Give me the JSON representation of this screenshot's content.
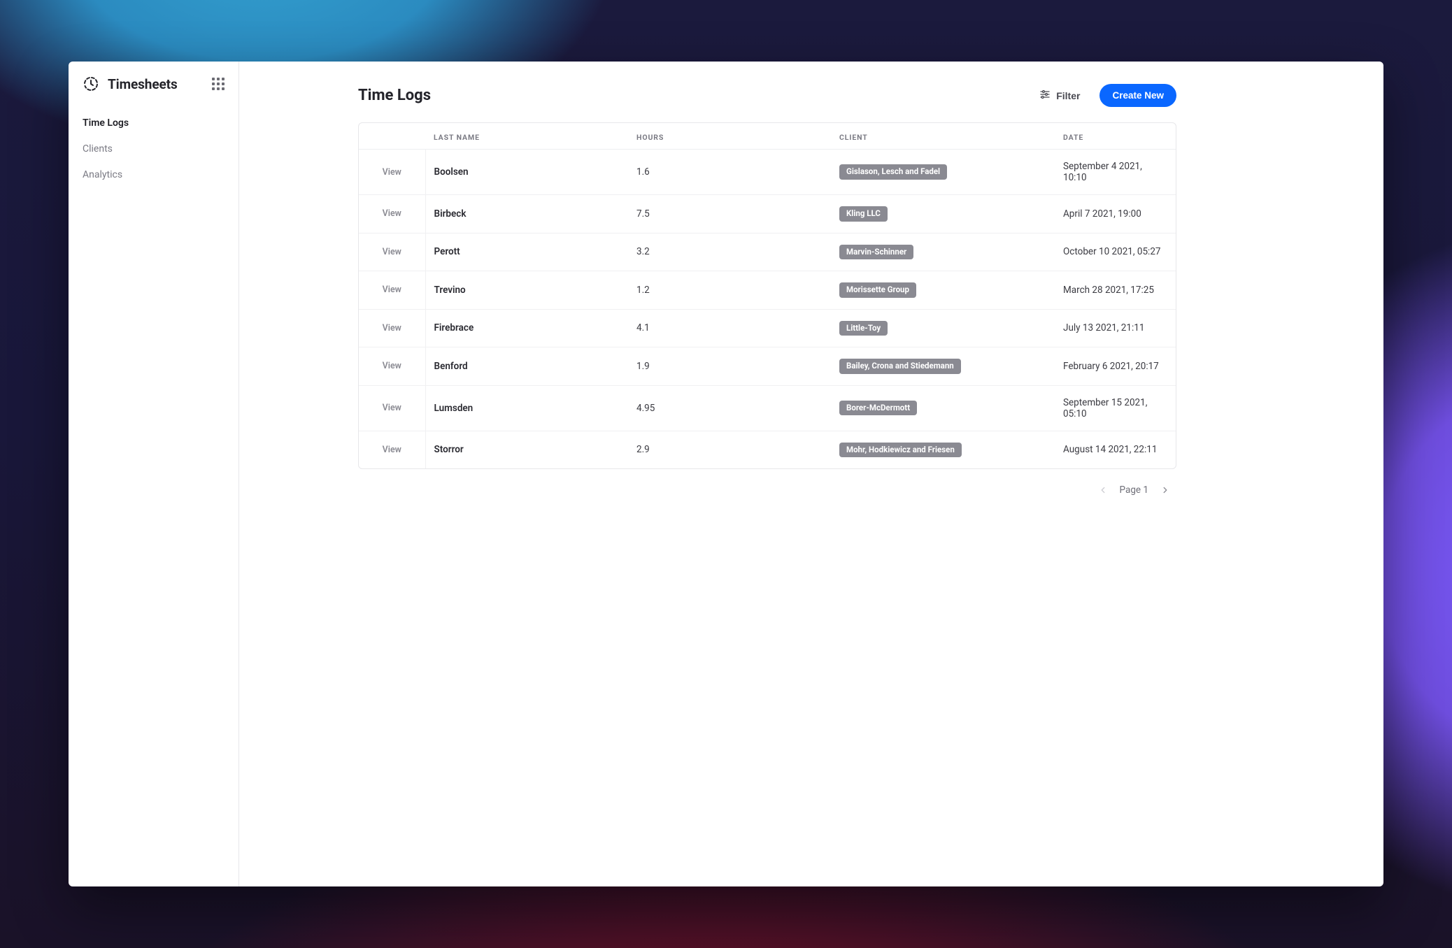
{
  "app": {
    "title": "Timesheets"
  },
  "sidebar": {
    "items": [
      {
        "label": "Time Logs",
        "active": true
      },
      {
        "label": "Clients",
        "active": false
      },
      {
        "label": "Analytics",
        "active": false
      }
    ]
  },
  "page": {
    "title": "Time Logs",
    "filter_label": "Filter",
    "create_label": "Create New",
    "pager_label": "Page 1"
  },
  "table": {
    "headers": {
      "action": "",
      "last_name": "Last Name",
      "hours": "Hours",
      "client": "Client",
      "date": "Date"
    },
    "view_label": "View",
    "rows": [
      {
        "last_name": "Boolsen",
        "hours": "1.6",
        "client": "Gislason, Lesch and Fadel",
        "date": "September 4 2021, 10:10"
      },
      {
        "last_name": "Birbeck",
        "hours": "7.5",
        "client": "Kling LLC",
        "date": "April 7 2021, 19:00"
      },
      {
        "last_name": "Perott",
        "hours": "3.2",
        "client": "Marvin-Schinner",
        "date": "October 10 2021, 05:27"
      },
      {
        "last_name": "Trevino",
        "hours": "1.2",
        "client": "Morissette Group",
        "date": "March 28 2021, 17:25"
      },
      {
        "last_name": "Firebrace",
        "hours": "4.1",
        "client": "Little-Toy",
        "date": "July 13 2021, 21:11"
      },
      {
        "last_name": "Benford",
        "hours": "1.9",
        "client": "Bailey, Crona and Stiedemann",
        "date": "February 6 2021, 20:17"
      },
      {
        "last_name": "Lumsden",
        "hours": "4.95",
        "client": "Borer-McDermott",
        "date": "September 15 2021, 05:10"
      },
      {
        "last_name": "Storror",
        "hours": "2.9",
        "client": "Mohr, Hodkiewicz and Friesen",
        "date": "August 14 2021, 22:11"
      }
    ]
  }
}
